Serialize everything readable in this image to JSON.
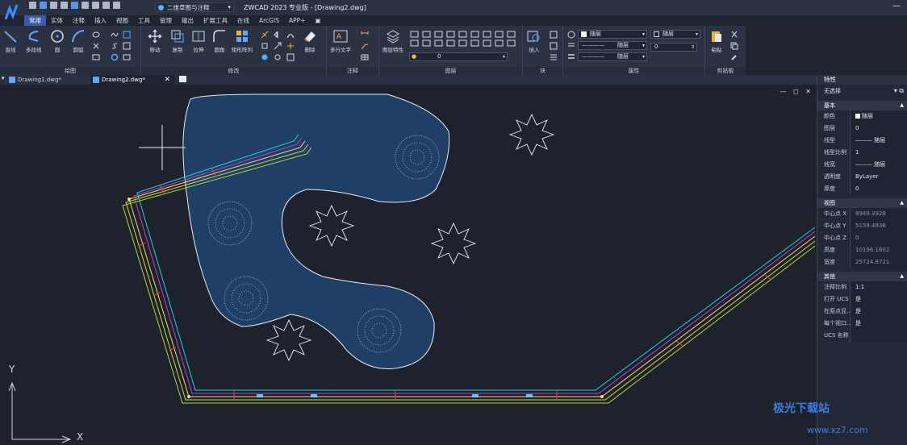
{
  "titlebar": {
    "workspace": "二维草图与注释",
    "title": "ZWCAD 2023 专业版 - [Drawing2.dwg]",
    "minimize": "—"
  },
  "tabs": [
    "常用",
    "实体",
    "注释",
    "插入",
    "视图",
    "工具",
    "管理",
    "输出",
    "扩展工具",
    "在线",
    "ArcGIS",
    "APP+",
    "▣"
  ],
  "ribbon": {
    "groups": {
      "draw": "绘图",
      "modify": "修改",
      "annotate": "注释",
      "layers": "图层",
      "block": "块",
      "properties": "属性",
      "clipboard": "剪贴板"
    },
    "tools": {
      "line": "直线",
      "polyline": "多段线",
      "circle": "圆",
      "arc": "圆弧",
      "move": "移动",
      "copy": "复制",
      "stretch": "拉伸",
      "fillet": "圆角",
      "array": "矩形阵列",
      "erase": "删除",
      "mtext": "多行文字",
      "layer_props": "图层特性",
      "insert": "插入",
      "paste": "粘贴"
    },
    "layer_combo": "0",
    "color_combo": "随层",
    "color_combo2": "随层",
    "linetype_combo": "随层",
    "lineweight_combo": "随层",
    "transparency_value": "0"
  },
  "doctabs": {
    "tab1": "Drawing1.dwg*",
    "tab2": "Drawing2.dwg*",
    "close": "✕"
  },
  "viewport_controls": "— ◻ ✕",
  "ucs": {
    "x": "X",
    "y": "Y"
  },
  "properties_panel": {
    "title": "特性",
    "selection": "无选择",
    "sections": {
      "basic": {
        "title": "基本",
        "rows": [
          {
            "k": "颜色",
            "v": "随层"
          },
          {
            "k": "图层",
            "v": "0"
          },
          {
            "k": "线型",
            "v": "——— 随层"
          },
          {
            "k": "线型比例",
            "v": "1"
          },
          {
            "k": "线宽",
            "v": "——— 随层"
          },
          {
            "k": "透明度",
            "v": "ByLayer"
          },
          {
            "k": "厚度",
            "v": "0"
          }
        ]
      },
      "view": {
        "title": "视图",
        "rows": [
          {
            "k": "中心点 X",
            "v": "8949.3928"
          },
          {
            "k": "中心点 Y",
            "v": "5159.4936"
          },
          {
            "k": "中心点 Z",
            "v": "0"
          },
          {
            "k": "高度",
            "v": "10196.1602"
          },
          {
            "k": "宽度",
            "v": "25724.8721"
          }
        ]
      },
      "misc": {
        "title": "其他",
        "rows": [
          {
            "k": "注释比例",
            "v": "1:1"
          },
          {
            "k": "打开 UCS ...",
            "v": "是"
          },
          {
            "k": "在原点显...",
            "v": "是"
          },
          {
            "k": "每个视口...",
            "v": "是"
          },
          {
            "k": "UCS 名称",
            "v": ""
          }
        ]
      }
    }
  },
  "watermark": {
    "line1": "极光下载站",
    "line2": "www.xz7.com"
  },
  "colors": {
    "pond_fill": "#1f3f66",
    "titlebar": "#2a3142",
    "ribbon": "#2b3243",
    "active_tab": "#3b5ba8",
    "canvas": "#1e222c"
  }
}
